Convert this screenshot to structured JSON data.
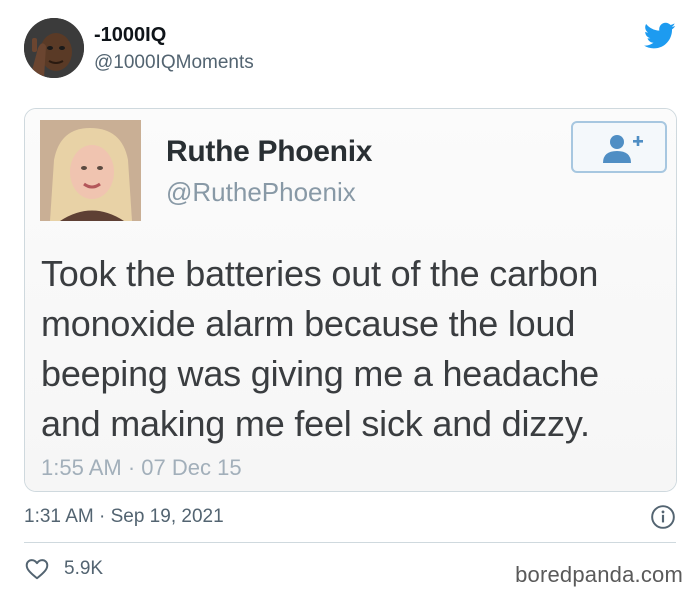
{
  "author": {
    "display_name": "-1000IQ",
    "handle": "@1000IQMoments",
    "avatar_icon": "avatar-meme-man-tapping-head"
  },
  "brand": {
    "icon": "twitter-bird-icon",
    "color": "#1d9bf0"
  },
  "embedded_tweet": {
    "display_name": "Ruthe Phoenix",
    "handle": "@RuthePhoenix",
    "text": "Took the batteries out of the carbon monoxide alarm because the loud beeping was giving me a headache and making me feel sick and dizzy.",
    "timestamp": "1:55 AM · 07 Dec 15",
    "follow_icon": "add-user-icon"
  },
  "tweet_meta": {
    "timestamp": "1:31 AM · Sep 19, 2021",
    "info_icon": "info-icon"
  },
  "engagement": {
    "like_icon": "heart-icon",
    "likes": "5.9K"
  },
  "watermark": "boredpanda.com"
}
